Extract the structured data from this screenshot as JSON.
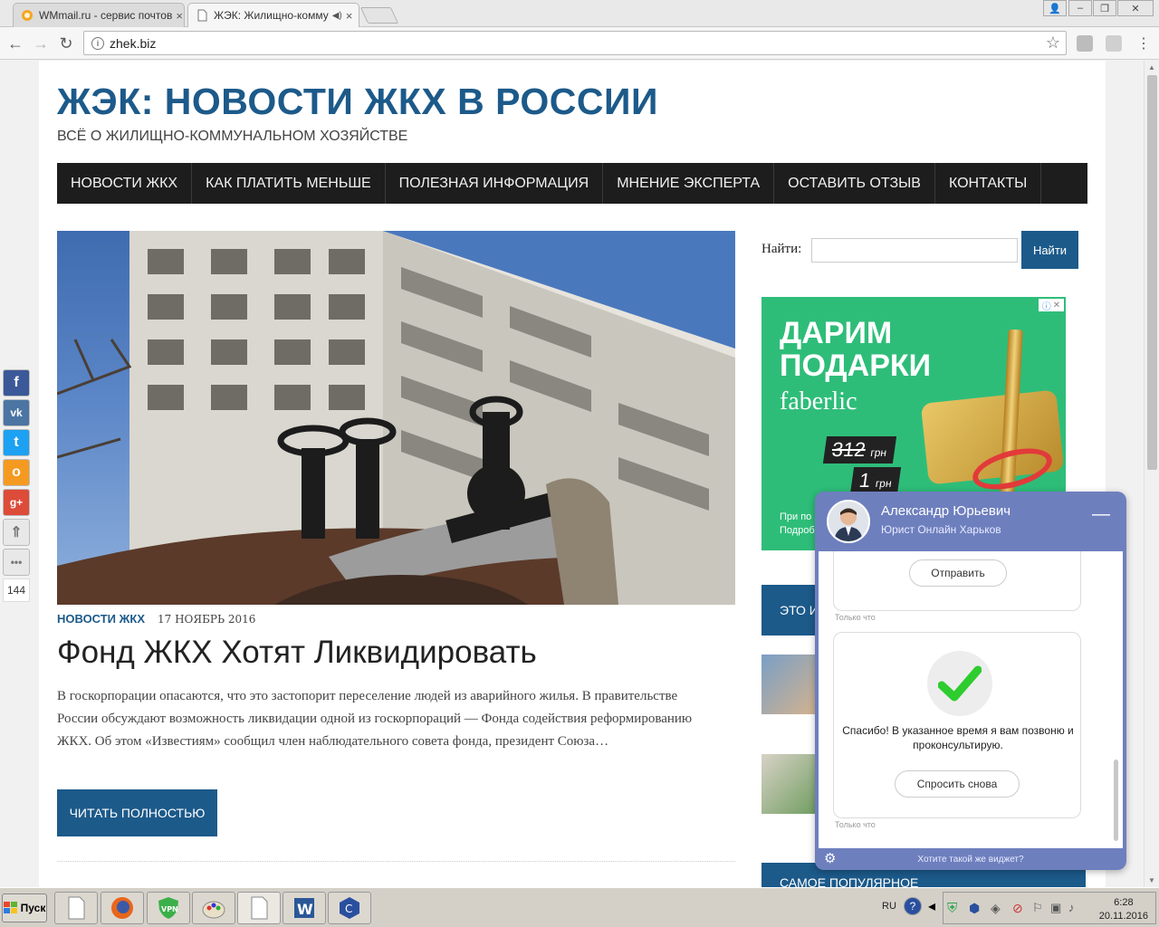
{
  "browser": {
    "tabs": [
      {
        "title": "WMmail.ru - сервис почтов",
        "active": false
      },
      {
        "title": "ЖЭК: Жилищно-комму",
        "active": true
      }
    ],
    "url": "zhek.biz"
  },
  "site": {
    "title": "ЖЭК: НОВОСТИ ЖКХ В РОССИИ",
    "description": "ВСЁ О ЖИЛИЩНО-КОММУНАЛЬНОМ ХОЗЯЙСТВЕ",
    "nav": [
      "НОВОСТИ ЖКХ",
      "КАК ПЛАТИТЬ МЕНЬШЕ",
      "ПОЛЕЗНАЯ ИНФОРМАЦИЯ",
      "МНЕНИЕ ЭКСПЕРТА",
      "ОСТАВИТЬ ОТЗЫВ",
      "КОНТАКТЫ"
    ]
  },
  "post": {
    "category": "НОВОСТИ ЖКХ",
    "date": "17 НОЯБРЬ 2016",
    "title": "Фонд ЖКХ Хотят Ликвидировать",
    "excerpt": "В госкорпорации опасаются, что это застопорит переселение людей из аварийного жилья. В правительстве России обсуждают возможность ликвидации одной из госкорпораций — Фонда содействия реформированию ЖКХ. Об этом «Известиям» сообщил член наблюдательного совета фонда, президент Союза…",
    "read_more": "ЧИТАТЬ ПОЛНОСТЬЮ"
  },
  "sidebar": {
    "search_label": "Найти:",
    "search_value": "",
    "search_button": "Найти",
    "box1_label": "ЭТО И",
    "box2_label": "САМОЕ ПОПУЛЯРНОЕ"
  },
  "ad": {
    "headline_1": "ДАРИМ",
    "headline_2": "ПОДАРКИ",
    "brand": "faberlic",
    "old_price": "312",
    "new_price": "1",
    "currency": "грн",
    "footer_1": "При по",
    "footer_2": "Подроб"
  },
  "share": {
    "count": "144"
  },
  "chat": {
    "agent_name": "Александр Юрьевич",
    "agent_role": "Юрист Онлайн Харьков",
    "send_button": "Отправить",
    "timestamp_1": "Только что",
    "thanks_text": "Спасибо! В указанное время я вам позвоню и проконсультирую.",
    "ask_again_button": "Спросить снова",
    "timestamp_2": "Только что",
    "footer_link": "Хотите такой же виджет?"
  },
  "taskbar": {
    "start_label": "Пуск",
    "language": "RU",
    "time": "6:28",
    "date": "20.11.2016"
  },
  "colors": {
    "brand_blue": "#1c5a8a",
    "nav_bg": "#1d1d1d",
    "ad_green": "#2ebd79",
    "chat_purple": "#6e7fbe"
  }
}
